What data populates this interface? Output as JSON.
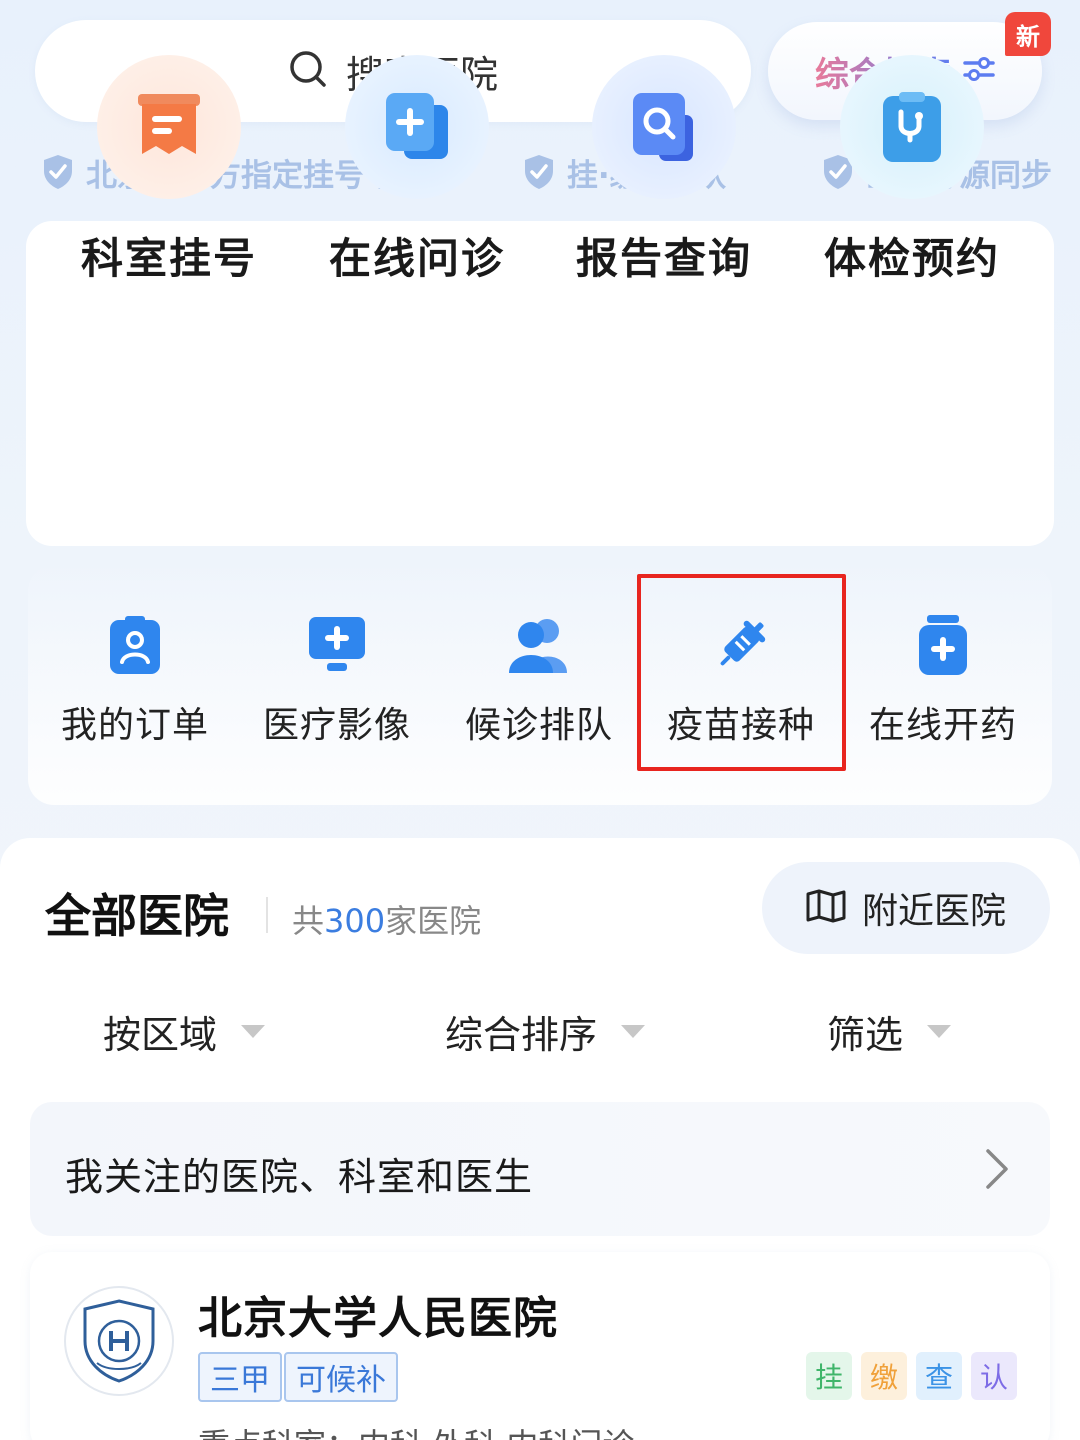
{
  "search": {
    "placeholder": "搜索医院"
  },
  "combo_search": {
    "label": "综合搜索",
    "badge": "新"
  },
  "trust": [
    "北京市官方指定挂号平台",
    "挂·缴·查·认",
    "医院号源同步"
  ],
  "services": [
    {
      "label": "科室挂号",
      "icon": "department-register-icon"
    },
    {
      "label": "在线问诊",
      "icon": "online-consult-icon"
    },
    {
      "label": "报告查询",
      "icon": "report-search-icon"
    },
    {
      "label": "体检预约",
      "icon": "checkup-appointment-icon"
    }
  ],
  "secondary": [
    {
      "label": "我的订单",
      "icon": "order-icon"
    },
    {
      "label": "医疗影像",
      "icon": "medical-imaging-icon"
    },
    {
      "label": "候诊排队",
      "icon": "queue-icon"
    },
    {
      "label": "疫苗接种",
      "icon": "vaccine-icon"
    },
    {
      "label": "在线开药",
      "icon": "prescription-icon"
    }
  ],
  "list": {
    "title": "全部医院",
    "count_prefix": "共",
    "count": "300",
    "count_suffix": "家医院",
    "nearby": "附近医院",
    "filters": [
      "按区域",
      "综合排序",
      "筛选"
    ],
    "follow": "我关注的医院、科室和医生",
    "hospital": {
      "name": "北京大学人民医院",
      "tags": [
        "三甲",
        "可候补"
      ],
      "services": [
        "挂",
        "缴",
        "查",
        "认"
      ],
      "key_depts": "重点科室：内科 外科 内科门诊"
    }
  },
  "colors": {
    "accent": "#3b7de0",
    "highlight": "#e8251f"
  }
}
